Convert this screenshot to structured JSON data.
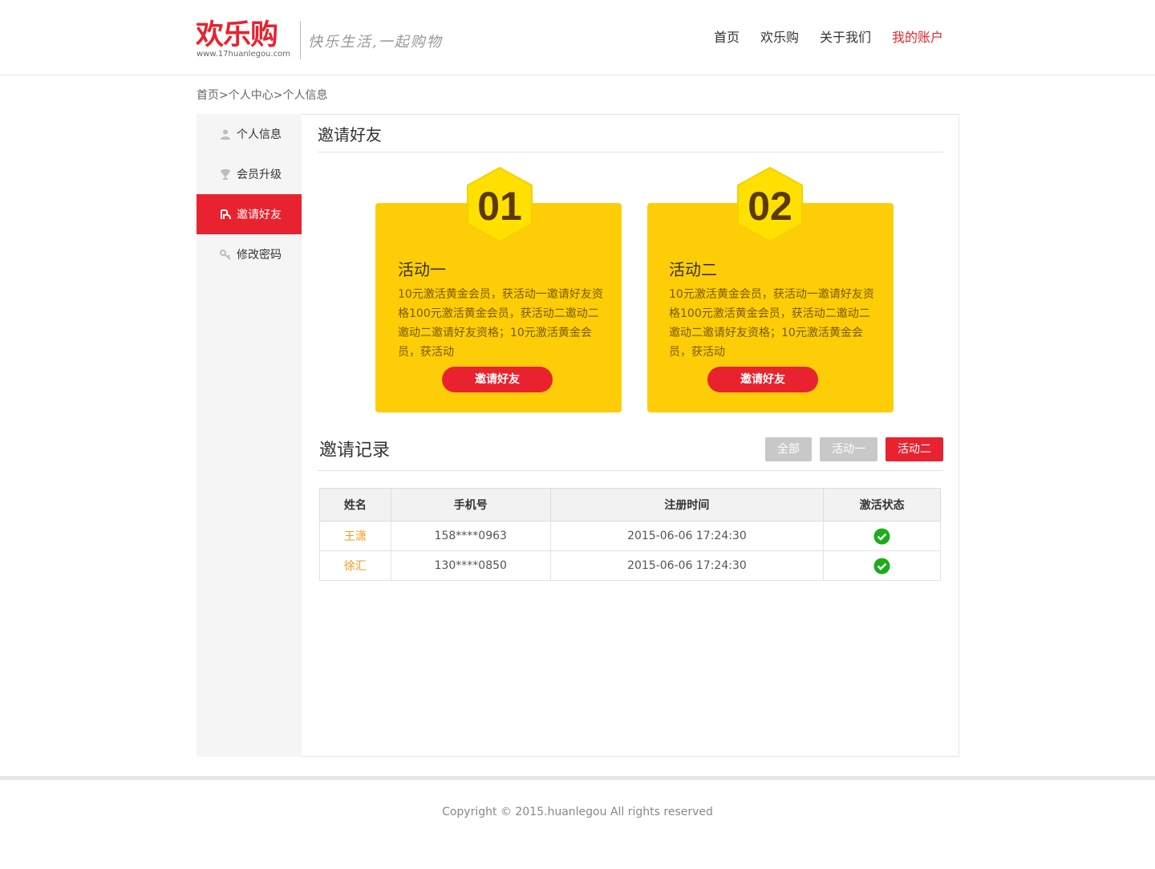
{
  "header": {
    "logo_text": "欢乐购",
    "logo_url": "www.17huanlegou.com",
    "slogan": "快乐生活,一起购物",
    "nav": [
      "首页",
      "欢乐购",
      "关于我们",
      "我的账户"
    ]
  },
  "breadcrumb": "首页>个人中心>个人信息",
  "sidebar": {
    "items": [
      {
        "label": "个人信息",
        "icon": "user-icon"
      },
      {
        "label": "会员升级",
        "icon": "trophy-icon"
      },
      {
        "label": "邀请好友",
        "icon": "invite-icon"
      },
      {
        "label": "修改密码",
        "icon": "key-icon"
      }
    ]
  },
  "invite": {
    "title": "邀请好友",
    "cards": [
      {
        "number": "01",
        "title": "活动一",
        "desc": "10元激活黄金会员，获活动一邀请好友资格100元激活黄金会员，获活动二邀动二邀动二邀请好友资格；10元激活黄金会员，获活动",
        "button": "邀请好友"
      },
      {
        "number": "02",
        "title": "活动二",
        "desc": "10元激活黄金会员，获活动一邀请好友资格100元激活黄金会员，获活动二邀动二邀动二邀请好友资格；10元激活黄金会员，获活动",
        "button": "邀请好友"
      }
    ]
  },
  "records": {
    "title": "邀请记录",
    "filters": [
      "全部",
      "活动一",
      "活动二"
    ],
    "columns": [
      "姓名",
      "手机号",
      "注册时间",
      "激活状态"
    ],
    "rows": [
      {
        "name": "王潇",
        "phone": "158****0963",
        "time": "2015-06-06 17:24:30",
        "status_icon": "check-circle-icon"
      },
      {
        "name": "徐汇",
        "phone": "130****0850",
        "time": "2015-06-06 17:24:30",
        "status_icon": "check-circle-icon"
      }
    ]
  },
  "footer": {
    "copyright": "Copyright © 2015.huanlegou All rights reserved"
  },
  "colors": {
    "brand_red": "#e8232f",
    "card_yellow": "#fdcd07",
    "hex_yellow": "#ffe000",
    "number_brown": "#5a3a00",
    "name_orange": "#f19a1b",
    "status_green": "#1aad19"
  }
}
